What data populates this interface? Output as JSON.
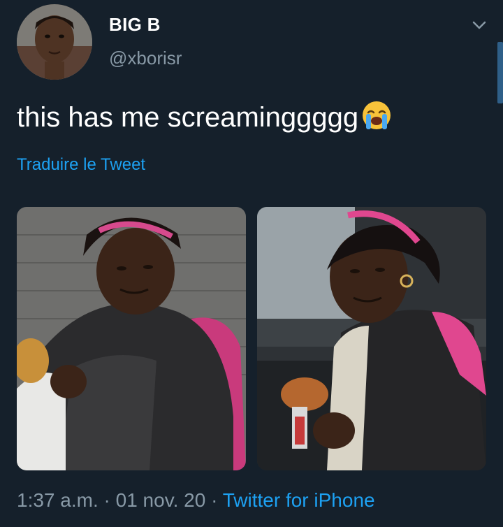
{
  "tweet": {
    "display_name": "BIG B",
    "handle": "@xborisr",
    "text": "this has me screaminggggg",
    "emoji_icon": "loudly-crying-face-icon",
    "translate_label": "Traduire le Tweet",
    "time": "1:37 a.m.",
    "separator": " · ",
    "date": "01 nov. 20",
    "source": "Twitter for iPhone"
  },
  "colors": {
    "background": "#15202b",
    "text": "#ffffff",
    "secondary": "#8899a6",
    "link": "#1da1f2"
  }
}
